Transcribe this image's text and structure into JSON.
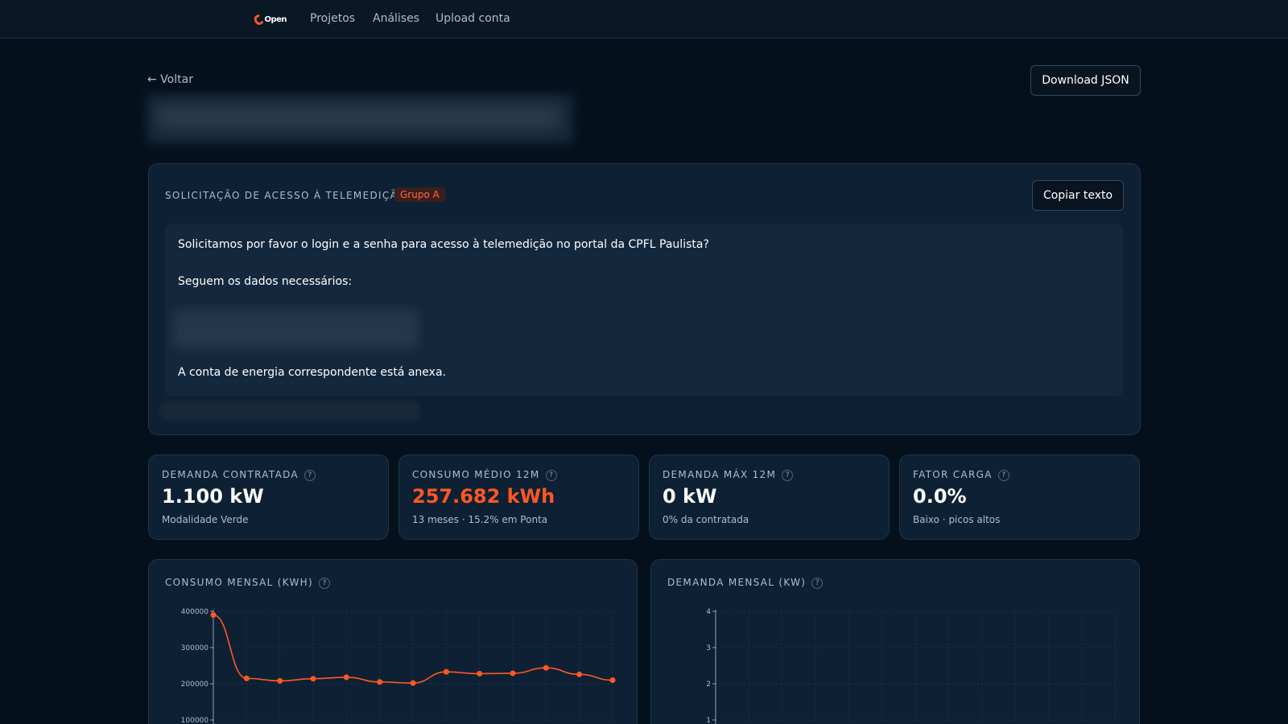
{
  "nav": {
    "logo_text": "Open",
    "links": [
      "Projetos",
      "Análises",
      "Upload conta"
    ]
  },
  "header": {
    "back_label": "← Voltar",
    "download_label": "Download JSON"
  },
  "request": {
    "title": "SOLICITAÇÃO DE ACESSO À TELEMEDIÇÃO",
    "badge": "Grupo A",
    "copy_label": "Copiar texto",
    "line1": "Solicitamos por favor o login e a senha para acesso à telemedição no portal da CPFL Paulista?",
    "line2": "Seguem os dados necessários:",
    "line3": "A conta de energia correspondente está anexa."
  },
  "kpis": [
    {
      "label": "DEMANDA CONTRATADA",
      "value": "1.100 kW",
      "sub": "Modalidade Verde",
      "color": "#ffffff"
    },
    {
      "label": "CONSUMO MÉDIO 12M",
      "value": "257.682 kWh",
      "sub": "13 meses · 15.2% em Ponta",
      "color": "#ff5722"
    },
    {
      "label": "DEMANDA MÁX 12M",
      "value": "0 kW",
      "sub": "0% da contratada",
      "color": "#ffffff"
    },
    {
      "label": "FATOR CARGA",
      "value": "0.0%",
      "sub": "Baixo · picos altos",
      "color": "#ffffff"
    }
  ],
  "charts_titles": {
    "consumo": "CONSUMO MENSAL (KWH)",
    "demanda": "DEMANDA MENSAL (KW)"
  },
  "colors": {
    "accent": "#ff5722",
    "background": "#04111c",
    "panel": "#0e2134"
  },
  "chart_data": [
    {
      "type": "line",
      "title": "CONSUMO MENSAL (KWH)",
      "yticks": [
        "400000",
        "300000",
        "200000",
        "100000"
      ],
      "ylim": [
        100000,
        400000
      ],
      "x": [
        1,
        2,
        3,
        4,
        5,
        6,
        7,
        8,
        9,
        10,
        11,
        12,
        13
      ],
      "series": [
        {
          "values": [
            390000,
            215000,
            208000,
            214000,
            218000,
            205000,
            202000,
            233000,
            228000,
            229000,
            244000,
            226000,
            210000
          ]
        }
      ],
      "grid": true
    },
    {
      "type": "line",
      "title": "DEMANDA MENSAL (KW)",
      "yticks": [
        "4",
        "3",
        "2",
        "1"
      ],
      "ylim": [
        1,
        4
      ],
      "series": [],
      "grid": true
    }
  ]
}
